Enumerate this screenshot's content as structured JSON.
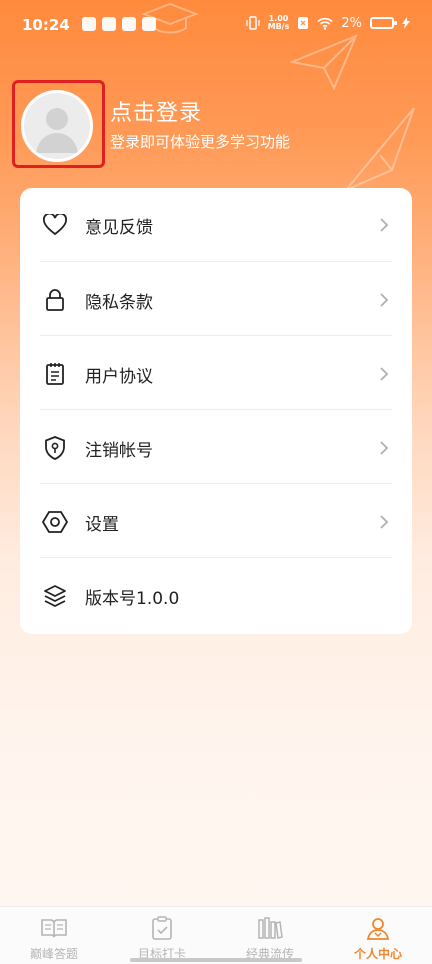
{
  "status_bar": {
    "time": "10:24",
    "net_speed_top": "1.00",
    "net_speed_bottom": "MB/s",
    "battery": "2%"
  },
  "profile": {
    "title": "点击登录",
    "subtitle": "登录即可体验更多学习功能"
  },
  "menu": {
    "items": [
      {
        "label": "意见反馈",
        "icon": "heart-icon"
      },
      {
        "label": "隐私条款",
        "icon": "lock-icon"
      },
      {
        "label": "用户协议",
        "icon": "notepad-icon"
      },
      {
        "label": "注销帐号",
        "icon": "shield-key-icon"
      },
      {
        "label": "设置",
        "icon": "settings-hexagon-icon"
      },
      {
        "label": "版本号1.0.0",
        "icon": "layers-icon"
      }
    ]
  },
  "tabbar": {
    "tabs": [
      {
        "label": "巅峰答题",
        "icon": "book-icon",
        "active": false
      },
      {
        "label": "目标打卡",
        "icon": "checklist-icon",
        "active": false
      },
      {
        "label": "经典流传",
        "icon": "bookshelf-icon",
        "active": false
      },
      {
        "label": "个人中心",
        "icon": "person-icon",
        "active": true
      }
    ]
  },
  "colors": {
    "accent": "#f0862f",
    "highlight_border": "#e02020",
    "card_bg": "#ffffff"
  }
}
